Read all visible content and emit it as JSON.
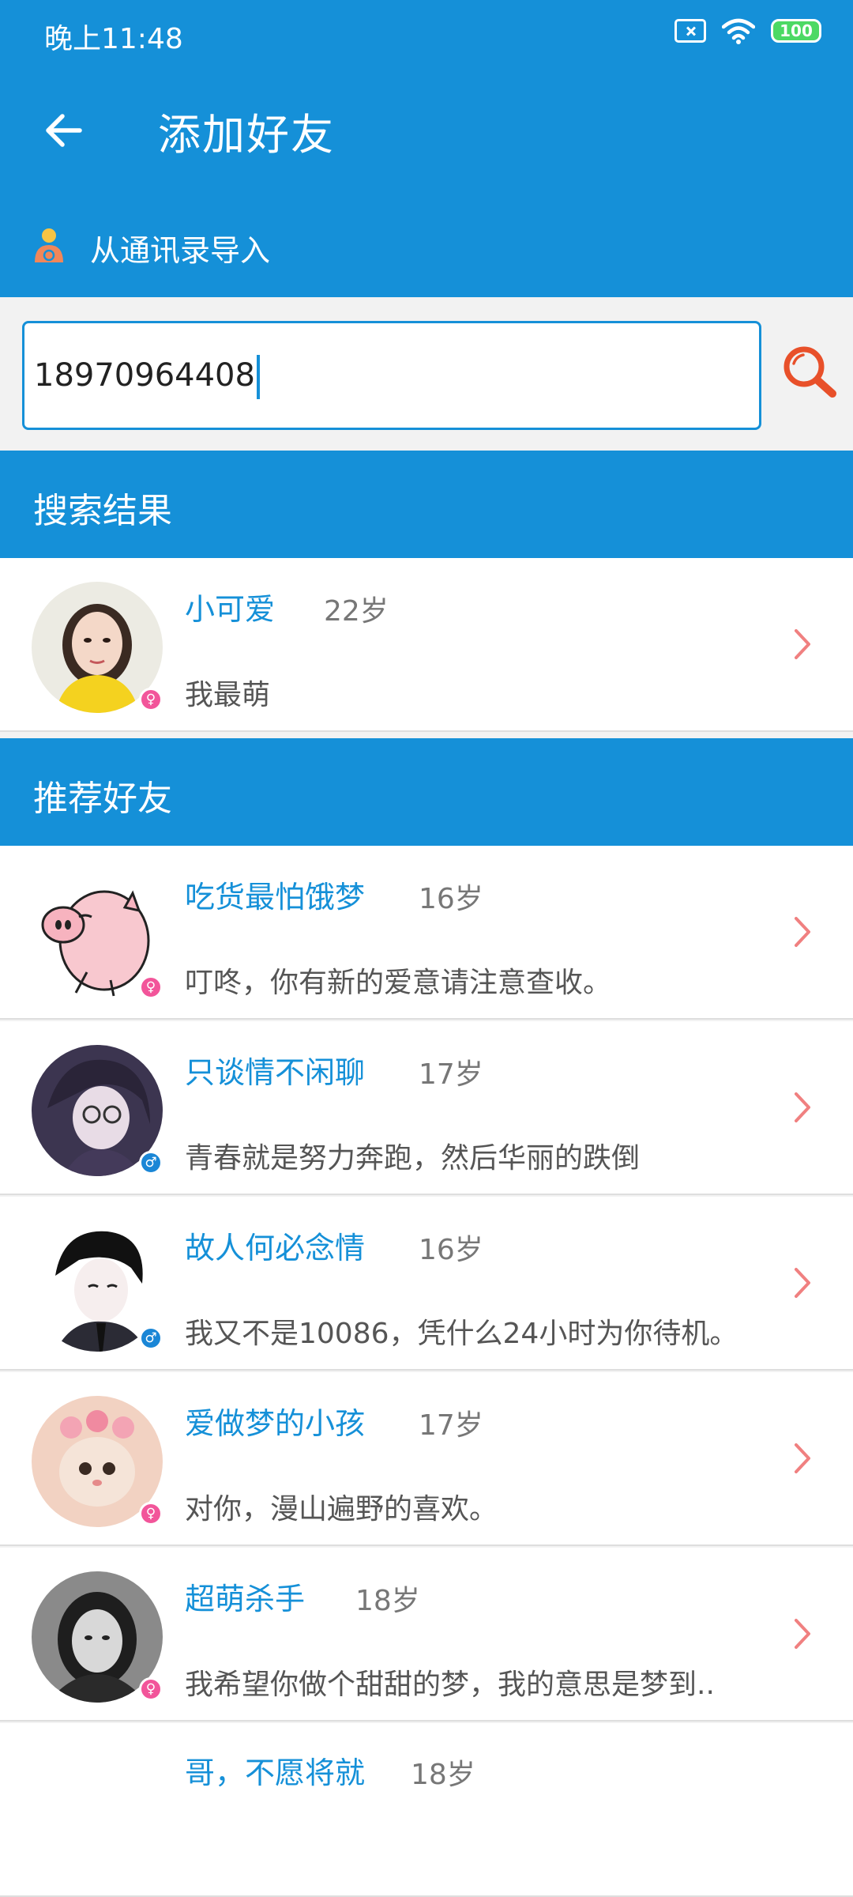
{
  "status_bar": {
    "time": "晚上11:48",
    "battery": "100",
    "icons": [
      "sim-error-icon",
      "wifi-icon",
      "battery-icon"
    ]
  },
  "header": {
    "title": "添加好友",
    "back_icon": "arrow-left-icon",
    "import_label": "从通讯录导入",
    "import_icon": "contacts-person-icon"
  },
  "search": {
    "value": "18970964408",
    "icon": "magnifier-icon"
  },
  "sections": {
    "results_title": "搜索结果",
    "recommend_title": "推荐好友"
  },
  "search_results": [
    {
      "name": "小可爱",
      "age": "22岁",
      "motto": "我最萌",
      "gender": "♀",
      "avatar": "portrait-woman-yellow-shirt"
    }
  ],
  "recommended": [
    {
      "name": "吃货最怕饿梦",
      "age": "16岁",
      "motto": "叮咚，你有新的爱意请注意查收。",
      "gender": "♀",
      "avatar": "cartoon-pink-pig"
    },
    {
      "name": "只谈情不闲聊",
      "age": "17岁",
      "motto": "青春就是努力奔跑，然后华丽的跌倒",
      "gender": "♂",
      "avatar": "anime-boy-glasses"
    },
    {
      "name": "故人何必念情",
      "age": "16岁",
      "motto": "我又不是10086，凭什么24小时为你待机。",
      "gender": "♂",
      "avatar": "anime-boy-suit"
    },
    {
      "name": "爱做梦的小孩",
      "age": "17岁",
      "motto": "对你，漫山遍野的喜欢。",
      "gender": "♀",
      "avatar": "kitten-flower-crown"
    },
    {
      "name": "超萌杀手",
      "age": "18岁",
      "motto": "我希望你做个甜甜的梦，我的意思是梦到..",
      "gender": "♀",
      "avatar": "portrait-woman-bw"
    },
    {
      "name": "哥，不愿将就",
      "age": "18岁",
      "motto": "",
      "gender": "♂",
      "avatar": ""
    }
  ],
  "colors": {
    "primary": "#1590d8",
    "name_text": "#1590d8",
    "chevron": "#f08080",
    "female_badge": "#f2559a",
    "male_badge": "#1a86d6"
  }
}
